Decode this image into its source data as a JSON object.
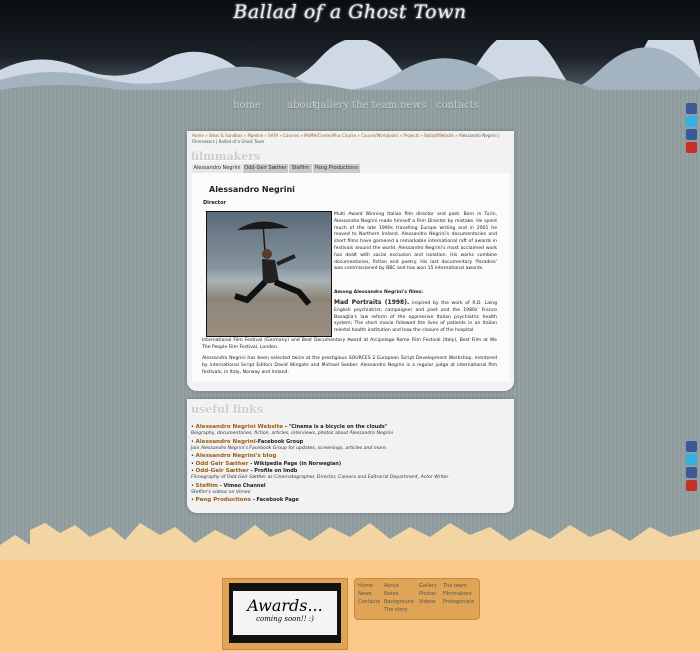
{
  "site_title": "Ballad of a Ghost Town",
  "nav": [
    "home",
    "about",
    "gallery",
    "the team",
    "news",
    "contacts"
  ],
  "social_icons": [
    "facebook-icon",
    "twitter-icon",
    "facebook-icon",
    "youtube-icon"
  ],
  "breadcrumb": {
    "links": "Home » Ideas & Sandbox » Pipeline » SAFA » Courses » MoMA/CinemaPlus Course » Course/Workbooks » Projects » Ballad/Website »",
    "current": "Alessandro Negrini | Filmmakers | Ballad of a Ghost Town"
  },
  "filmmakers_heading": "filmmakers",
  "tabs": [
    "Alessandro Negrini",
    "Odd-Geir Sæther",
    "Stefilm",
    "Pang Productions"
  ],
  "profile": {
    "name": "Alessandro Negrini",
    "role": "Director",
    "bio_1": "Multi Award Winning Italian film director and poet. Born in Turin, Alessandro Negrini made himself a Film Director by mistake. He spent much of the late 1990s travelling Europe writing and in 2001 he moved to Northern Ireland. Alessandro Negrini's documentaries and short films have garnered a remarkable international raft of awards in festivals around the world. Alessandro Negrini's most acclaimed work has dealt with social exclusion and isolation. His works combine documentaries, fiction and poetry. His last documentary 'Paradiso' was commissioned by BBC and has won 15 international awards.",
    "films_heading": "Among Alessandro Negrini's films:",
    "film_title": "Mad Portraits (1998).",
    "bio_2": "inspired by the work of R.D. Laing English psychiatrist, campaigner and poet and the 1980s' Franco Basaglia's law reform of the oppressive Italian psychiatric health system; The short movie followed the lives of patients in an Italian mental health institution and how the closure of the hospital",
    "bio_3": "International Film Festival (Germany) and Best Documentary Award at Arcipelago Rome Film Festival (Italy), Best Film at We The People Film Festival, London.",
    "bio_4": "Alessandro Negrini has been selected twice at the prestigious SOURCES 2 European Script Development Workshop, mentored by international Script Editors David Wingate and Michael Seeber. Alessandro Negrini is a regular judge at international film festivals, in Italy, Norway and Ireland."
  },
  "useful_links_heading": "useful links",
  "useful_links": [
    {
      "link": "Alessandro Negrini Website",
      "tail": " - \"Cinema is a bicycle on the clouds\"",
      "desc": "Biography, documentaries, fiction, articles, interviews, photos about Alessandro Negrini"
    },
    {
      "link": "Alessandro Negrini",
      "tail": "-Facebook Group",
      "desc": "Join Alessandro Negrini's Facebook Group for updates, screenings, articles and more."
    },
    {
      "link": "Alessandro Negrini's blog",
      "tail": "",
      "desc": ""
    },
    {
      "link": "Odd Geir Sæther",
      "tail": " - Wikipedia Page (in Norwegian)",
      "desc": ""
    },
    {
      "link": "Odd-Geir Sæther",
      "tail": " - Profile on Imdb",
      "desc": "Filmography of Odd-Geir Sæther as Cinematographer, Director, Camera and Editrorial Department, Actor Writer"
    },
    {
      "link": "Stefilm",
      "tail": " - Vimeo Channel",
      "desc": "Stefilm's videos on Vimeo"
    },
    {
      "link": "Pang Productions",
      "tail": " - Facebook Page",
      "desc": ""
    }
  ],
  "awards": {
    "title": "Awards...",
    "subtitle": "coming soon!! :)"
  },
  "footer_nav": {
    "col1": [
      "Home",
      "News",
      "Contacts"
    ],
    "col2": [
      "About",
      "Notes",
      "Background",
      "The story"
    ],
    "col3": [
      "Gallery",
      "Photos",
      "Videos"
    ],
    "col4": [
      "The team",
      "Filmmakers",
      "Protagonists"
    ]
  }
}
